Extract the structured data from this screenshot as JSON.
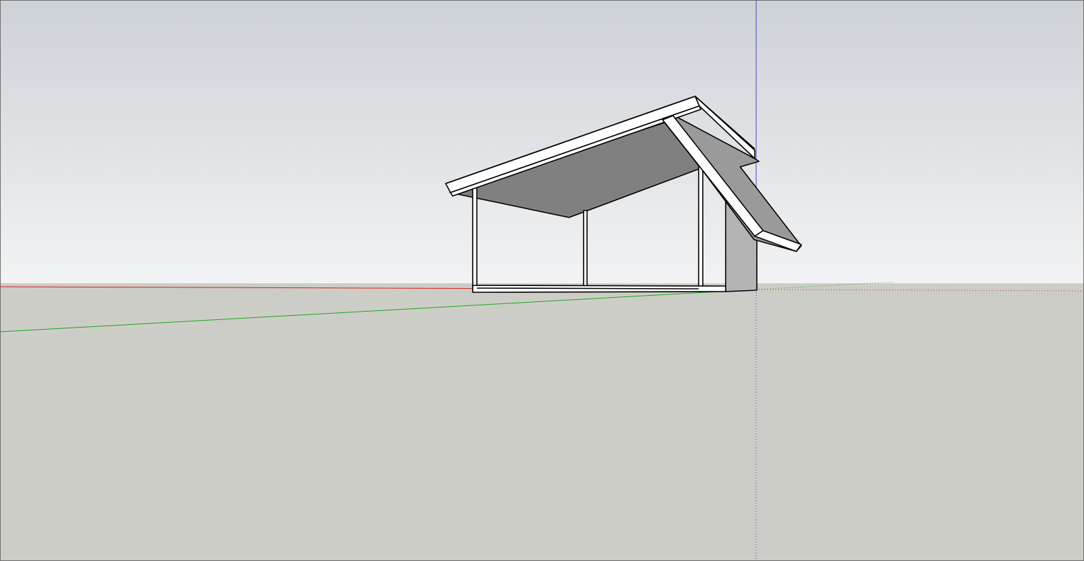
{
  "app": {
    "view": "perspective",
    "sky_color_top": "#cdd2d7",
    "sky_color_horizon": "#f2f3f4",
    "ground_color": "#cdcdc7"
  },
  "axes": {
    "red_axis_color": "#d81f1f",
    "green_axis_color": "#1ea41e",
    "blue_axis_color": "#4646c8"
  },
  "model": {
    "name": "",
    "object": "shed",
    "roof_face_color": "#ffffff",
    "roof_underside_color": "#808080",
    "side_wall_color": "#b4b4b4",
    "edge_color": "#000000"
  }
}
